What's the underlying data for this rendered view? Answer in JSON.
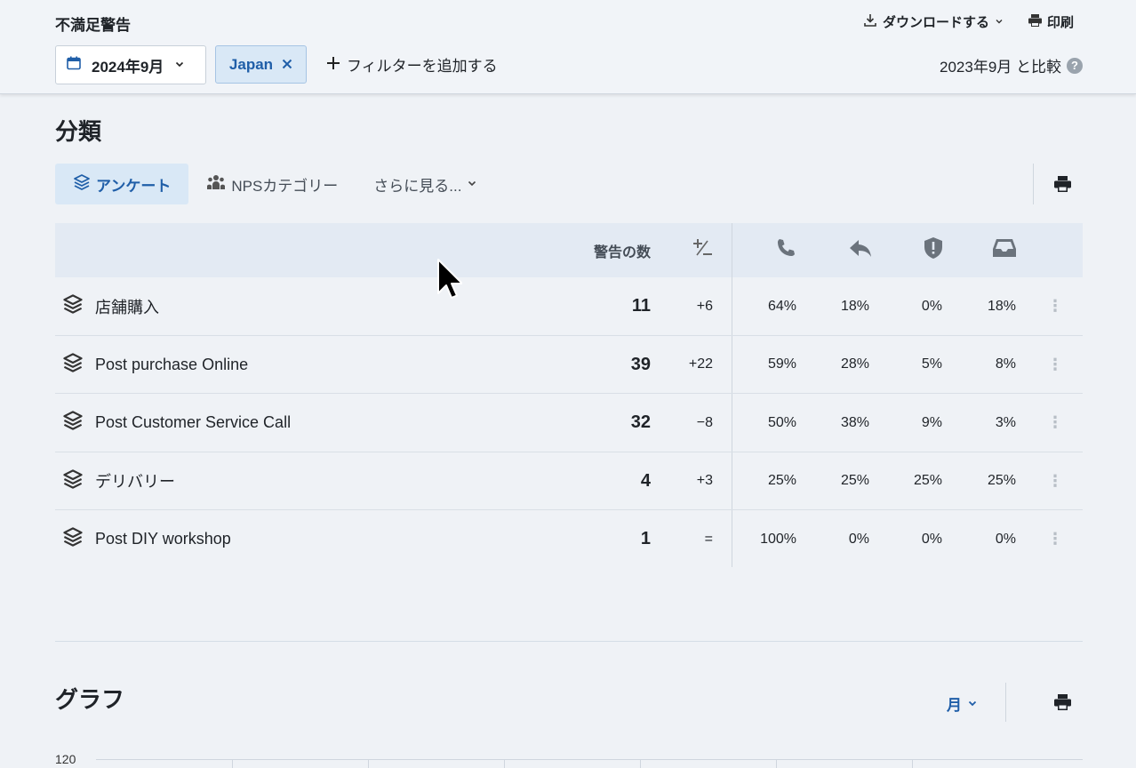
{
  "header": {
    "title": "不満足警告",
    "download_label": "ダウンロードする",
    "print_label": "印刷",
    "date_value": "2024年9月",
    "filter_chip": "Japan",
    "add_filter_label": "フィルターを追加する",
    "compare_label": "2023年9月 と比較",
    "help_symbol": "?"
  },
  "classification": {
    "title": "分類",
    "tabs": [
      {
        "label": "アンケート",
        "icon": "layers-icon",
        "active": true
      },
      {
        "label": "NPSカテゴリー",
        "icon": "people-icon",
        "active": false
      },
      {
        "label": "さらに見る...",
        "icon": "chevron-down-icon",
        "active": false
      }
    ],
    "table": {
      "headers": {
        "count": "警告の数",
        "diff_icon": "plus-minus-icon",
        "col_icons": [
          "phone-icon",
          "reply-icon",
          "shield-alert-icon",
          "inbox-icon"
        ]
      },
      "rows": [
        {
          "name": "店舗購入",
          "count": "11",
          "diff": "+6",
          "p1": "64%",
          "p2": "18%",
          "p3": "0%",
          "p4": "18%"
        },
        {
          "name": "Post purchase Online",
          "count": "39",
          "diff": "+22",
          "p1": "59%",
          "p2": "28%",
          "p3": "5%",
          "p4": "8%"
        },
        {
          "name": "Post Customer Service Call",
          "count": "32",
          "diff": "−8",
          "p1": "50%",
          "p2": "38%",
          "p3": "9%",
          "p4": "3%"
        },
        {
          "name": "デリバリー",
          "count": "4",
          "diff": "+3",
          "p1": "25%",
          "p2": "25%",
          "p3": "25%",
          "p4": "25%"
        },
        {
          "name": "Post DIY workshop",
          "count": "1",
          "diff": "=",
          "p1": "100%",
          "p2": "0%",
          "p3": "0%",
          "p4": "0%"
        }
      ]
    }
  },
  "graph": {
    "title": "グラフ",
    "period_label": "月",
    "y_top_tick": "120"
  },
  "colors": {
    "accent": "#1f5ea8",
    "chip_bg": "#d9e8f6",
    "background": "#eff2f6"
  }
}
